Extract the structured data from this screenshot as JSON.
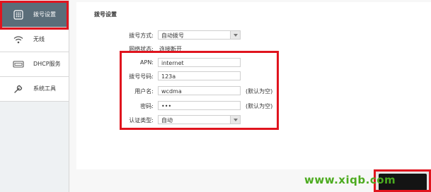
{
  "sidebar": {
    "items": [
      {
        "label": "拨号设置",
        "icon": "dialpad-icon",
        "active": true
      },
      {
        "label": "无线",
        "icon": "wifi-icon"
      },
      {
        "label": "DHCP服务",
        "icon": "dhcp-icon"
      },
      {
        "label": "系统工具",
        "icon": "wrench-icon"
      }
    ]
  },
  "main": {
    "title": "拨号设置",
    "dial_mode": {
      "label": "拨号方式:",
      "value": "自动拨号"
    },
    "net_status": {
      "label": "网络状态:",
      "value": "连接断开"
    },
    "apn": {
      "label": "APN:",
      "value": "internet"
    },
    "dial_number": {
      "label": "拨号号码:",
      "value": "123a"
    },
    "username": {
      "label": "用户名:",
      "value": "wcdma",
      "hint": "(默认为空)"
    },
    "password": {
      "label": "密码:",
      "value": "•••",
      "hint": "(默认为空)"
    },
    "auth_type": {
      "label": "认证类型:",
      "value": "自动"
    }
  },
  "watermark": "www.xiqb.com",
  "colors": {
    "sidebar_active": "#5a6d79",
    "annotation_red": "#e0141e",
    "watermark_green": "#4cab1f"
  }
}
